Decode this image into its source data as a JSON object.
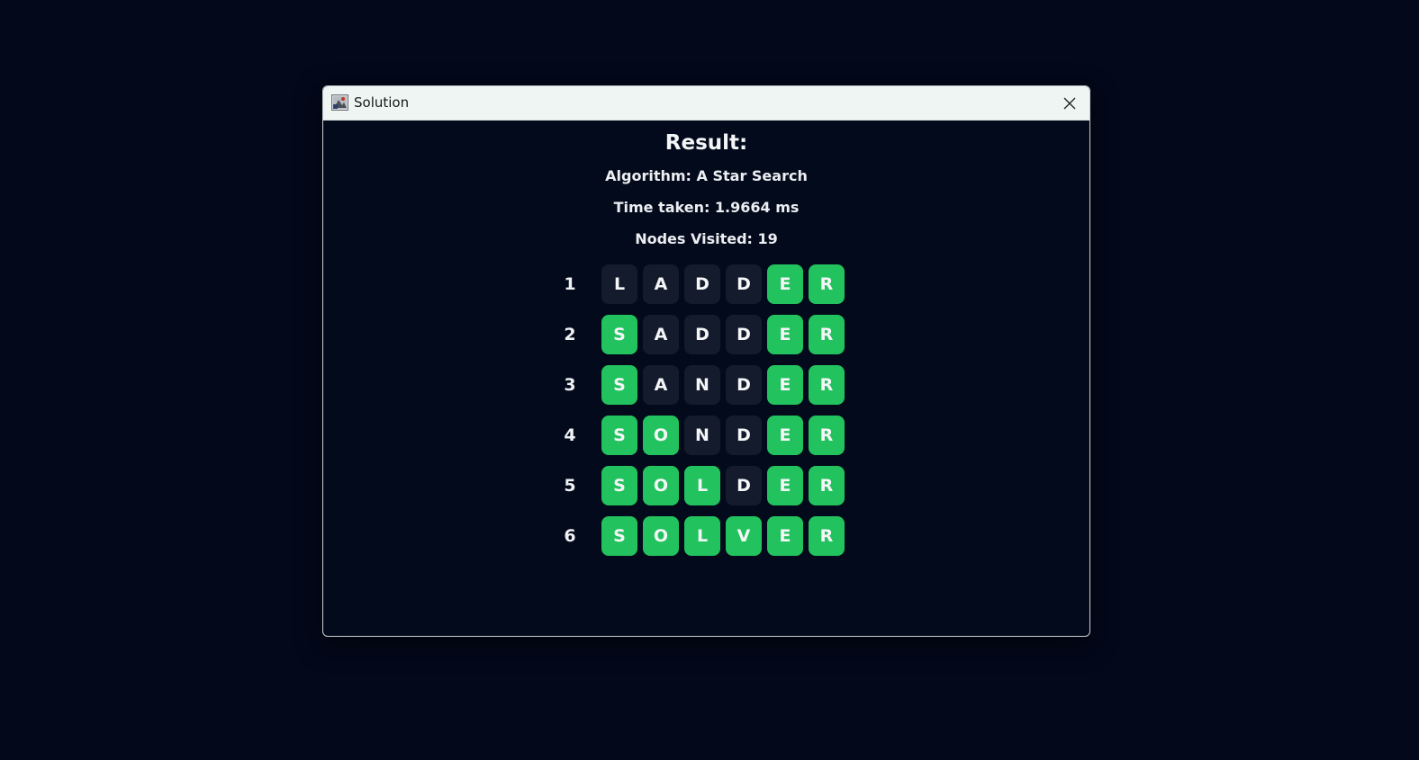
{
  "window": {
    "title": "Solution"
  },
  "result": {
    "heading": "Result:",
    "algorithm": "Algorithm: A Star Search",
    "time_taken": "Time taken: 1.9664 ms",
    "nodes_visited": "Nodes Visited: 19"
  },
  "colors": {
    "match": "#22c35e",
    "nonmatch": "#141b2d",
    "background": "#03081a"
  },
  "rows": [
    {
      "number": "1",
      "letters": [
        "L",
        "A",
        "D",
        "D",
        "E",
        "R"
      ],
      "match": [
        false,
        false,
        false,
        false,
        true,
        true
      ]
    },
    {
      "number": "2",
      "letters": [
        "S",
        "A",
        "D",
        "D",
        "E",
        "R"
      ],
      "match": [
        true,
        false,
        false,
        false,
        true,
        true
      ]
    },
    {
      "number": "3",
      "letters": [
        "S",
        "A",
        "N",
        "D",
        "E",
        "R"
      ],
      "match": [
        true,
        false,
        false,
        false,
        true,
        true
      ]
    },
    {
      "number": "4",
      "letters": [
        "S",
        "O",
        "N",
        "D",
        "E",
        "R"
      ],
      "match": [
        true,
        true,
        false,
        false,
        true,
        true
      ]
    },
    {
      "number": "5",
      "letters": [
        "S",
        "O",
        "L",
        "D",
        "E",
        "R"
      ],
      "match": [
        true,
        true,
        true,
        false,
        true,
        true
      ]
    },
    {
      "number": "6",
      "letters": [
        "S",
        "O",
        "L",
        "V",
        "E",
        "R"
      ],
      "match": [
        true,
        true,
        true,
        true,
        true,
        true
      ]
    }
  ]
}
